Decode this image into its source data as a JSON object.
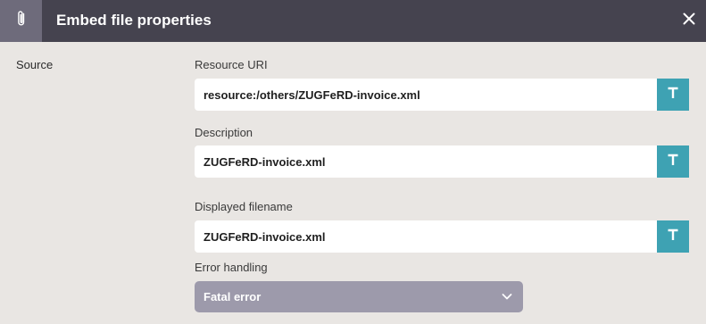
{
  "dialog": {
    "title": "Embed file properties",
    "header_icon": "paperclip-icon",
    "close_icon": "close-icon"
  },
  "section": {
    "label": "Source"
  },
  "fields": [
    {
      "label": "Resource URI",
      "value": "resource:/others/ZUGFeRD-invoice.xml",
      "button": "T"
    },
    {
      "label": "Description",
      "value": "ZUGFeRD-invoice.xml",
      "button": "T"
    },
    {
      "label": "Displayed filename",
      "value": "ZUGFeRD-invoice.xml",
      "button": "T"
    }
  ],
  "error_handling": {
    "label": "Error handling",
    "selected": "Fatal error"
  },
  "colors": {
    "header_bg": "#45434f",
    "header_icon_bg": "#6e6b7b",
    "page_bg": "#e9e6e3",
    "accent_button": "#3ea2b3",
    "select_bg": "#9d9aab"
  }
}
